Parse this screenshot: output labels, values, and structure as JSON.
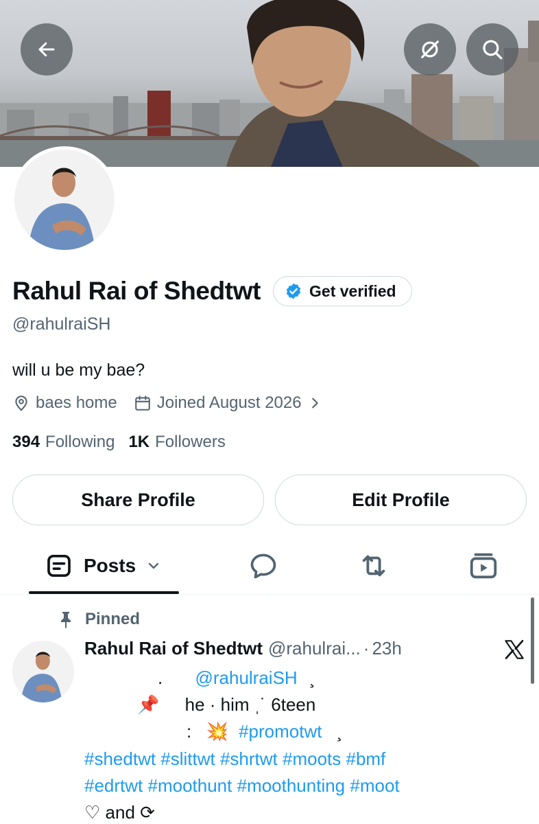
{
  "profile": {
    "display_name": "Rahul Rai of Shedtwt",
    "verify_label": "Get verified",
    "handle": "@rahulraiSH",
    "bio": "will u be my bae?",
    "location": "baes home",
    "joined": "Joined August 2026",
    "following_count": "394",
    "following_label": "Following",
    "followers_count": "1K",
    "followers_label": "Followers"
  },
  "actions": {
    "share_label": "Share Profile",
    "edit_label": "Edit Profile"
  },
  "tabs": {
    "posts_label": "Posts"
  },
  "tweet": {
    "pinned_label": "Pinned",
    "name": "Rahul Rai of Shedtwt",
    "handle": "@rahulrai...",
    "separator": "·",
    "time": "23h",
    "line1_dot": ".",
    "line1_mention": "@rahulraiSH",
    "line1_end": "¸",
    "line2_pin": "📌",
    "line2_text": "he · him ˌ˙ 6teen",
    "line3_colon": ":",
    "line3_emoji": "💥",
    "line3_tag": "#promotwt",
    "line3_end": "¸",
    "hashtags_line1": "#shedtwt #slittwt #shrtwt #moots #bmf",
    "hashtags_line2": "#edrtwt #moothunt #moothunting #moot",
    "last_line": "♡ and ⟳"
  },
  "icons": {
    "back": "arrow-left-icon",
    "grok": "grok-icon",
    "search": "search-icon",
    "verified": "verified-badge-icon",
    "location": "location-pin-icon",
    "calendar": "calendar-icon",
    "chevron": "chevron-right-icon",
    "posts": "posts-tab-icon",
    "replies": "replies-tab-icon",
    "reposts": "reposts-tab-icon",
    "media": "media-tab-icon",
    "pin": "pin-icon",
    "x_logo": "x-logo-icon"
  },
  "colors": {
    "accent": "#1d9bf0",
    "text": "#0f1419",
    "secondary": "#536471",
    "border": "#cfd9de"
  }
}
